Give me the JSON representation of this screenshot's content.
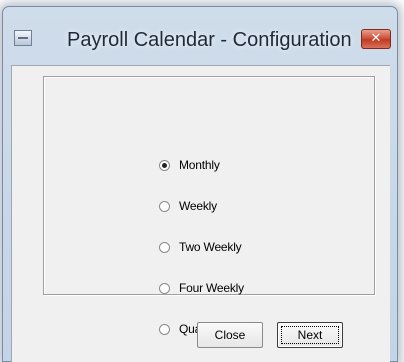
{
  "window": {
    "title": "Payroll Calendar - Configuration",
    "close_glyph": "✕"
  },
  "frequency": {
    "selected": "Monthly",
    "options": [
      "Monthly",
      "Weekly",
      "Two Weekly",
      "Four Weekly",
      "Quarterly"
    ]
  },
  "buttons": {
    "close_label": "Close",
    "next_label": "Next"
  },
  "icons": {
    "system_menu": "window-icon",
    "close": "close-icon"
  },
  "colors": {
    "frame": "#c4d4e6",
    "client": "#f0f0f0",
    "close_button": "#c03a22"
  }
}
